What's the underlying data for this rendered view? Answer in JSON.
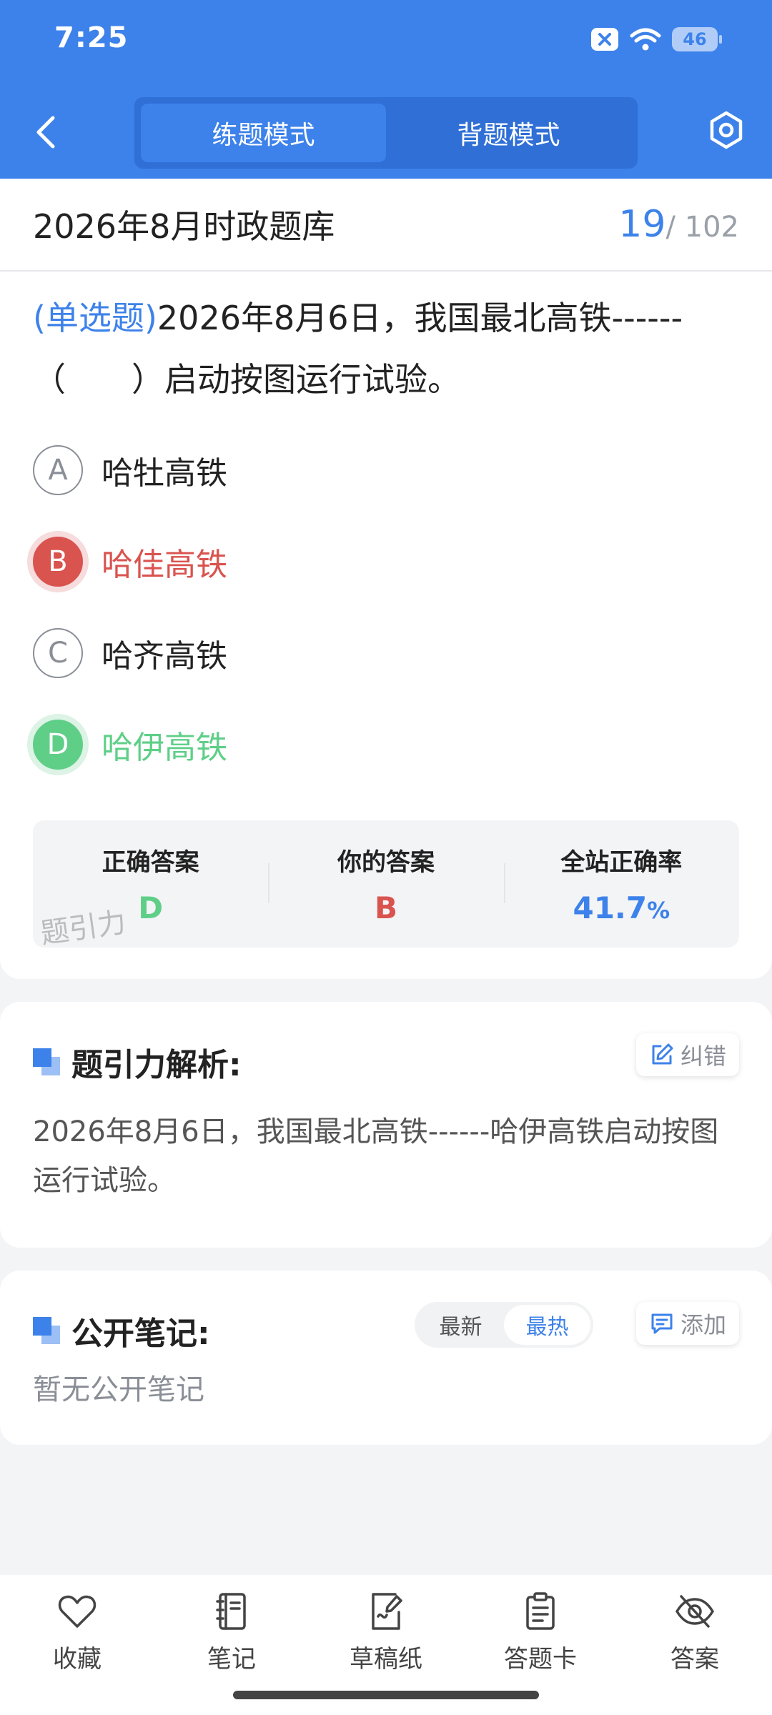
{
  "status_bar": {
    "time": "7:25",
    "battery": "46"
  },
  "header": {
    "tabs": [
      {
        "label": "练题模式",
        "active": true
      },
      {
        "label": "背题模式",
        "active": false
      }
    ]
  },
  "question": {
    "bank_title": "2026年8月时政题库",
    "current": "19",
    "total": "/ 102",
    "type_tag": "(单选题)",
    "text": "2026年8月6日，我国最北高铁------（　　）启动按图运行试验。",
    "options": [
      {
        "letter": "A",
        "text": "哈牡高铁",
        "state": "normal"
      },
      {
        "letter": "B",
        "text": "哈佳高铁",
        "state": "wrong"
      },
      {
        "letter": "C",
        "text": "哈齐高铁",
        "state": "normal"
      },
      {
        "letter": "D",
        "text": "哈伊高铁",
        "state": "correct"
      }
    ]
  },
  "answer_summary": {
    "correct_label": "正确答案",
    "correct_value": "D",
    "yours_label": "你的答案",
    "yours_value": "B",
    "rate_label": "全站正确率",
    "rate_value": "41.7",
    "rate_unit": "%",
    "watermark": "题引力"
  },
  "analysis": {
    "title": "题引力解析:",
    "report_button": "纠错",
    "text": "2026年8月6日，我国最北高铁------哈伊高铁启动按图运行试验。"
  },
  "notes": {
    "title": "公开笔记:",
    "sort_options": [
      "最新",
      "最热"
    ],
    "active_sort": "最热",
    "add_button": "添加",
    "empty_text": "暂无公开笔记"
  },
  "bottom_bar": {
    "items": [
      {
        "label": "收藏",
        "icon": "heart-icon"
      },
      {
        "label": "笔记",
        "icon": "notebook-icon"
      },
      {
        "label": "草稿纸",
        "icon": "draft-paper-icon"
      },
      {
        "label": "答题卡",
        "icon": "answer-card-icon"
      },
      {
        "label": "答案",
        "icon": "eye-off-icon"
      }
    ]
  },
  "colors": {
    "primary": "#3d82ea",
    "wrong": "#d9534f",
    "correct": "#5fcf88"
  }
}
